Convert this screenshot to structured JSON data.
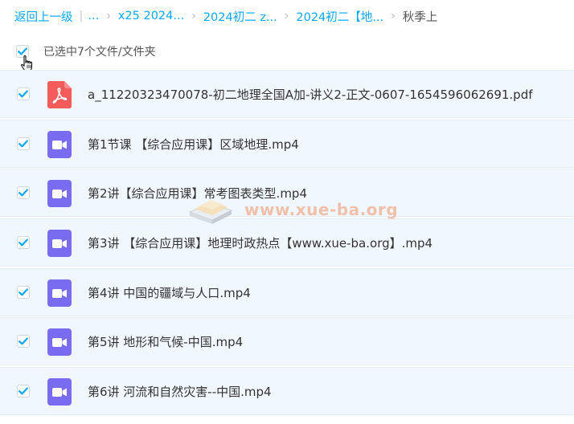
{
  "breadcrumb": {
    "back_label": "返回上一级",
    "ellipsis_label": "...",
    "crumbs": [
      {
        "label": "x25 2024..."
      },
      {
        "label": "2024初二 z..."
      },
      {
        "label": "2024初二【地..."
      }
    ],
    "current_label": "秋季上"
  },
  "selection": {
    "label": "已选中7个文件/文件夹",
    "checked": true
  },
  "files": [
    {
      "name": "a_11220323470078-初二地理全国A加-讲义2-正文-0607-1654596062691.pdf",
      "type": "pdf",
      "icon": "pdf-file-icon",
      "checked": true
    },
    {
      "name": "第1节课 【综合应用课】区域地理.mp4",
      "type": "video",
      "icon": "video-file-icon",
      "checked": true
    },
    {
      "name": "第2讲【综合应用课】常考图表类型.mp4",
      "type": "video",
      "icon": "video-file-icon",
      "checked": true
    },
    {
      "name": "第3讲 【综合应用课】地理时政热点【www.xue-ba.org】.mp4",
      "type": "video",
      "icon": "video-file-icon",
      "checked": true
    },
    {
      "name": "第4讲 中国的疆域与人口.mp4",
      "type": "video",
      "icon": "video-file-icon",
      "checked": true
    },
    {
      "name": "第5讲 地形和气候-中国.mp4",
      "type": "video",
      "icon": "video-file-icon",
      "checked": true
    },
    {
      "name": "第6讲 河流和自然灾害--中国.mp4",
      "type": "video",
      "icon": "video-file-icon",
      "checked": true
    }
  ],
  "watermark": {
    "text": "www.xue-ba.org"
  },
  "colors": {
    "link": "#06a7ff",
    "checkbox_check": "#06a7ff",
    "row_bg": "#f0f7ff",
    "pdf_icon": "#f45b5b",
    "video_icon": "#7a6cf0"
  }
}
